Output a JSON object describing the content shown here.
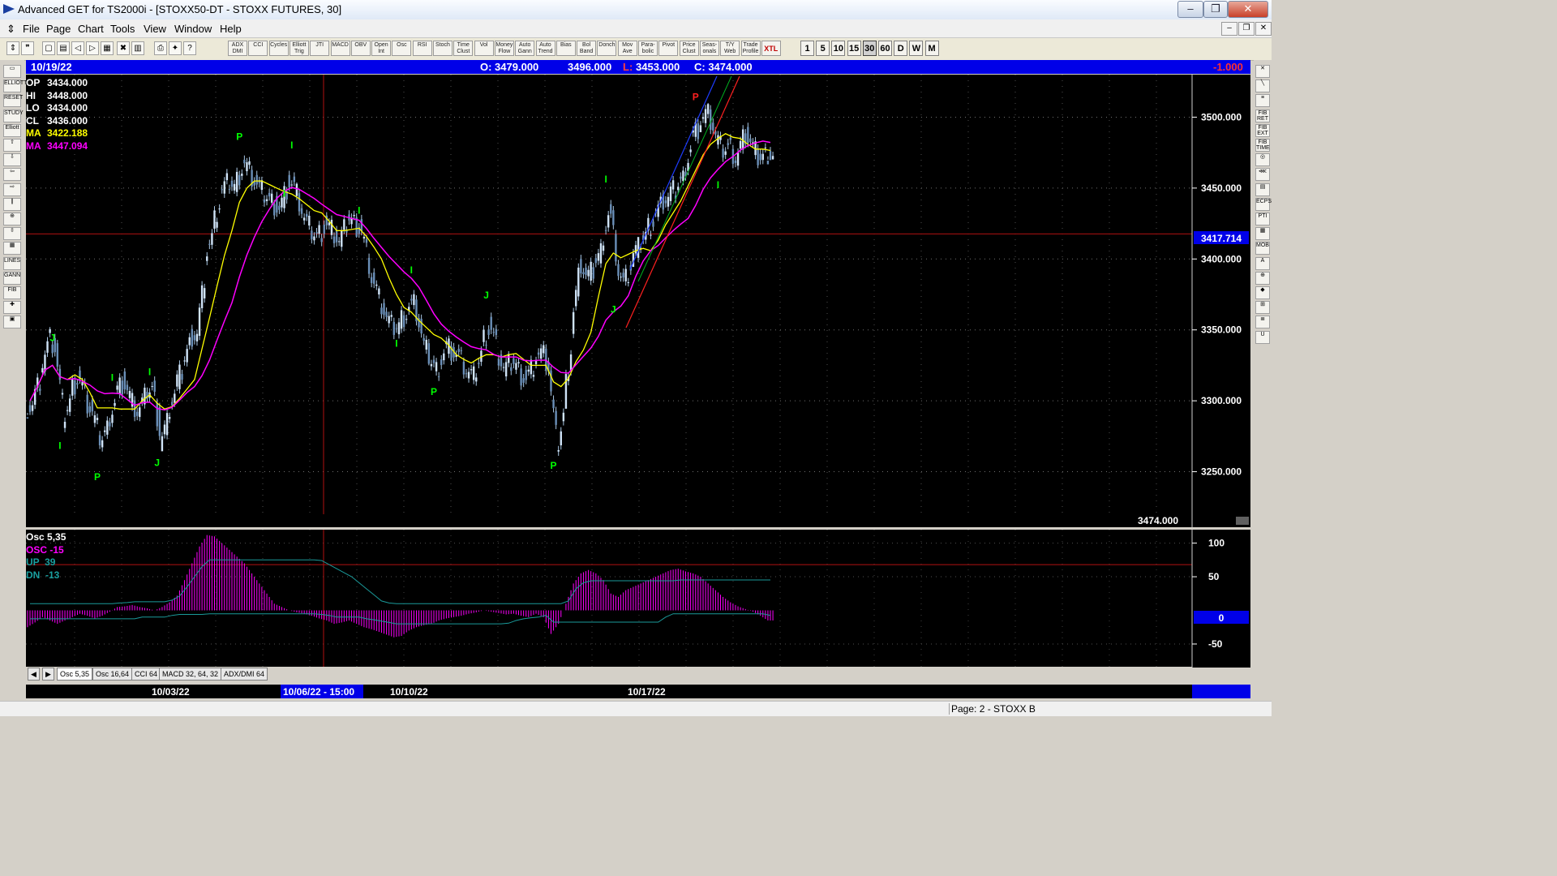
{
  "window": {
    "title": "Advanced GET for TS2000i - [STOXX50-DT - STOXX FUTURES, 30]",
    "min": "–",
    "max": "❐",
    "close": "✕"
  },
  "menu": [
    "File",
    "Page",
    "Chart",
    "Tools",
    "View",
    "Window",
    "Help"
  ],
  "mdi": {
    "min": "‒",
    "restore": "❐",
    "close": "✕"
  },
  "toolbar": {
    "studies": [
      "ADX DMI",
      "CCI",
      "Cycles",
      "Elliott Trig",
      "JTI",
      "MACD",
      "OBV",
      "Open Int",
      "Osc",
      "RSI",
      "Stoch",
      "Time Clust",
      "Vol",
      "Money Flow",
      "Auto Gann",
      "Auto Trend",
      "Bias",
      "Bol Band",
      "Donch",
      "Mov Ave",
      "Para-bolic",
      "Pivot",
      "Price Clust",
      "Seas-onals",
      "T/Y Web",
      "Trade Profile",
      "XTL"
    ],
    "intervals": [
      "1",
      "5",
      "10",
      "15",
      "30",
      "60",
      "D",
      "W",
      "M"
    ],
    "selected_interval": "30"
  },
  "left_tools": [
    "▭",
    "ELLIOTT",
    "RESET",
    "STUDY",
    "Elliott",
    "⇧",
    "⇩",
    "⇦",
    "⇨",
    "∥",
    "⊕",
    "⇳",
    "▦",
    "LINES",
    "GANN",
    "FIB",
    "✚",
    "▣"
  ],
  "right_tools": [
    "✕",
    "╲",
    "≡",
    "FIB RET",
    "FIB EXT",
    "FIB TIME",
    "◎",
    "⋘",
    "▤",
    "ECPS",
    "PTI",
    "▦",
    "MOB",
    "A",
    "⊕",
    "◆",
    "⊞",
    "≣",
    "U"
  ],
  "infobar": {
    "date": "10/19/22",
    "open": "O: 3479.000",
    "high": "3496.000",
    "low_label": "L:",
    "low": "3453.000",
    "close": "C: 3474.000",
    "change": "-1.000"
  },
  "legend": [
    {
      "label": "OP",
      "value": "3434.000",
      "color": "#ffffff"
    },
    {
      "label": "HI",
      "value": "3448.000",
      "color": "#ffffff"
    },
    {
      "label": "LO",
      "value": "3434.000",
      "color": "#ffffff"
    },
    {
      "label": "CL",
      "value": "3436.000",
      "color": "#ffffff"
    },
    {
      "label": "MA",
      "value": "3422.188",
      "color": "#ffff00"
    },
    {
      "label": "MA",
      "value": "3447.094",
      "color": "#ff00ff"
    }
  ],
  "price_axis": {
    "ticks": [
      "3500.000",
      "3450.000",
      "3400.000",
      "3350.000",
      "3300.000",
      "3250.000"
    ],
    "cursor_label": "3417.714",
    "last_price": "3474.000"
  },
  "markers": [
    {
      "t": "J",
      "c": "#00ff00",
      "i": 3,
      "p": 3342
    },
    {
      "t": "I",
      "c": "#00ff00",
      "i": 4,
      "p": 3266
    },
    {
      "t": "P",
      "c": "#00ff00",
      "i": 9,
      "p": 3244
    },
    {
      "t": "I",
      "c": "#00ff00",
      "i": 11,
      "p": 3314
    },
    {
      "t": "I",
      "c": "#00ff00",
      "i": 16,
      "p": 3318
    },
    {
      "t": "J",
      "c": "#00ff00",
      "i": 17,
      "p": 3254
    },
    {
      "t": "P",
      "c": "#00ff00",
      "i": 28,
      "p": 3484
    },
    {
      "t": "I",
      "c": "#00ff00",
      "i": 34,
      "p": 3444
    },
    {
      "t": "I",
      "c": "#00ff00",
      "i": 35,
      "p": 3478
    },
    {
      "t": "I",
      "c": "#00ff00",
      "i": 44,
      "p": 3432
    },
    {
      "t": "I",
      "c": "#00ff00",
      "i": 49,
      "p": 3338
    },
    {
      "t": "I",
      "c": "#00ff00",
      "i": 51,
      "p": 3390
    },
    {
      "t": "P",
      "c": "#00ff00",
      "i": 54,
      "p": 3304
    },
    {
      "t": "J",
      "c": "#00ff00",
      "i": 61,
      "p": 3372
    },
    {
      "t": "P",
      "c": "#00ff00",
      "i": 70,
      "p": 3252
    },
    {
      "t": "I",
      "c": "#00ff00",
      "i": 77,
      "p": 3454
    },
    {
      "t": "J",
      "c": "#00ff00",
      "i": 78,
      "p": 3362
    },
    {
      "t": "P",
      "c": "#ff2020",
      "i": 89,
      "p": 3512
    },
    {
      "t": "I",
      "c": "#00ff00",
      "i": 92,
      "p": 3450
    }
  ],
  "osc": {
    "label": "Osc 5,35",
    "osc": "OSC -15",
    "up": "UP  39",
    "dn": "DN  -13",
    "ticks": [
      "100",
      "50",
      "-50"
    ],
    "zero_label": "0"
  },
  "tabs": [
    "Osc 5,35",
    "Osc 16,64",
    "CCI 64",
    "MACD 32, 64, 32",
    "ADX/DMI 64"
  ],
  "date_axis": {
    "dates": [
      "10/03/22",
      "10/10/22",
      "10/17/22"
    ],
    "cursor_date": "10/06/22 - 15:00"
  },
  "status": "Page: 2 - STOXX B",
  "chart_data": {
    "type": "candlestick",
    "interval_minutes": 30,
    "ylim": [
      3220,
      3530
    ],
    "y_ticks": [
      3250,
      3300,
      3350,
      3400,
      3450,
      3500
    ],
    "cursor_price": 3417.714,
    "last_price": 3474,
    "close": [
      3300,
      3320,
      3345,
      3335,
      3285,
      3305,
      3320,
      3300,
      3290,
      3270,
      3285,
      3305,
      3315,
      3300,
      3290,
      3305,
      3310,
      3270,
      3290,
      3310,
      3325,
      3345,
      3350,
      3400,
      3420,
      3445,
      3455,
      3450,
      3470,
      3460,
      3450,
      3445,
      3440,
      3435,
      3455,
      3450,
      3430,
      3420,
      3415,
      3425,
      3420,
      3410,
      3430,
      3425,
      3420,
      3390,
      3375,
      3360,
      3350,
      3355,
      3365,
      3370,
      3340,
      3330,
      3320,
      3340,
      3335,
      3330,
      3320,
      3315,
      3340,
      3355,
      3335,
      3320,
      3330,
      3320,
      3315,
      3330,
      3335,
      3320,
      3260,
      3300,
      3350,
      3400,
      3385,
      3395,
      3410,
      3440,
      3395,
      3380,
      3400,
      3410,
      3420,
      3430,
      3440,
      3445,
      3450,
      3460,
      3485,
      3495,
      3505,
      3490,
      3475,
      3480,
      3470,
      3490,
      3480,
      3470,
      3475,
      3474
    ],
    "ma_fast": {
      "label": "MA",
      "value": 3422.188,
      "color": "#ffff00"
    },
    "ma_slow": {
      "label": "MA",
      "value": 3447.094,
      "color": "#ff00ff"
    },
    "osc_values": [
      -25,
      -18,
      -10,
      -15,
      -20,
      -15,
      -10,
      -5,
      -8,
      -12,
      -8,
      -2,
      5,
      6,
      8,
      5,
      3,
      0,
      5,
      12,
      22,
      45,
      70,
      95,
      112,
      110,
      100,
      90,
      80,
      70,
      55,
      40,
      25,
      10,
      5,
      0,
      -3,
      -5,
      -8,
      -12,
      -15,
      -20,
      -18,
      -15,
      -20,
      -25,
      -28,
      -32,
      -36,
      -40,
      -38,
      -30,
      -25,
      -22,
      -20,
      -15,
      -12,
      -10,
      -8,
      -5,
      -3,
      0,
      -2,
      -4,
      -6,
      -5,
      -8,
      -10,
      -5,
      -10,
      -35,
      -20,
      10,
      40,
      55,
      60,
      55,
      45,
      25,
      20,
      30,
      35,
      40,
      45,
      50,
      55,
      60,
      62,
      58,
      55,
      50,
      40,
      30,
      20,
      12,
      6,
      2,
      -2,
      -8,
      -15
    ],
    "osc_ylim": [
      -85,
      120
    ],
    "osc_up_band": 39,
    "osc_dn_band": -13
  }
}
